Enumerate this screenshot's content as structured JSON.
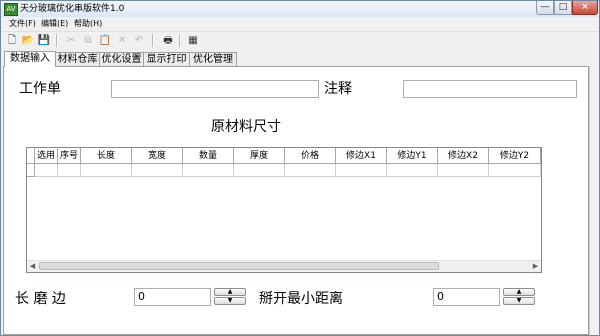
{
  "window": {
    "title": "天分玻璃优化串版软件1.0",
    "app_icon": "app-icon",
    "minimize": "—",
    "maximize": "□",
    "close": "×"
  },
  "menu": [
    "文件(F)",
    "编辑(E)",
    "帮助(H)"
  ],
  "toolbar": [
    {
      "name": "new-file-icon",
      "glyph": "🗋"
    },
    {
      "name": "open-folder-icon",
      "glyph": "📂"
    },
    {
      "name": "save-icon",
      "glyph": "💾"
    },
    {
      "name": "cut-icon",
      "glyph": "✂"
    },
    {
      "name": "copy-icon",
      "glyph": "⧉"
    },
    {
      "name": "paste-icon",
      "glyph": "📋"
    },
    {
      "name": "delete-icon",
      "glyph": "✕"
    },
    {
      "name": "undo-icon",
      "glyph": "↶"
    },
    {
      "name": "print-icon",
      "glyph": "🖶"
    },
    {
      "name": "grid-icon",
      "glyph": "▦"
    }
  ],
  "tabs": [
    "数据输入",
    "材料仓库",
    "优化设置",
    "显示打印",
    "优化管理"
  ],
  "active_tab": "数据输入",
  "form": {
    "work_order_label": "工作单",
    "work_order_value": "",
    "note_label": "注释",
    "note_value": "",
    "section_title": "原材料尺寸"
  },
  "table": {
    "columns": [
      "选用",
      "序号",
      "长度",
      "宽度",
      "数量",
      "厚度",
      "价格",
      "修边X1",
      "修边Y1",
      "修边X2",
      "修边Y2"
    ],
    "rows": []
  },
  "edge_grind": {
    "label": "长 磨 边",
    "value": "0"
  },
  "break_distance": {
    "label": "掰开最小距离",
    "value": "0"
  },
  "colors": {
    "frame": "#6d88a8",
    "close_button": "#c8473a",
    "app_icon": "#3a8a2e"
  }
}
